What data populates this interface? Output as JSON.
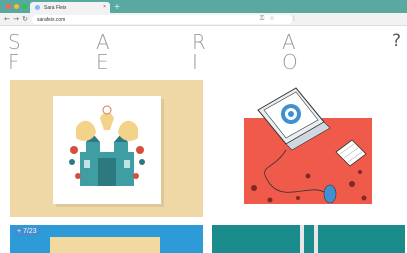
{
  "browser": {
    "tab_title": "Sara Fleix",
    "tab_close": "×",
    "new_tab": "+",
    "back": "←",
    "forward": "→",
    "reload": "↻",
    "url": "sarafeix.com",
    "url_icons": [
      "key-icon",
      "star-icon",
      "menu-icon"
    ]
  },
  "header": {
    "row1": [
      "S",
      "A",
      "R",
      "A"
    ],
    "row2": [
      "F",
      "E",
      "I",
      "O"
    ],
    "help": "?"
  },
  "gallery": {
    "badge": "+ 7/23"
  },
  "colors": {
    "chrome": "#5aa9a0",
    "card_sand": "#efd8a6",
    "card_white": "#ffffff",
    "teal_art": "#3f9ea3",
    "red_art": "#ef5a4b",
    "blue_card": "#2d9bd8",
    "teal_card": "#1a8c8c"
  }
}
